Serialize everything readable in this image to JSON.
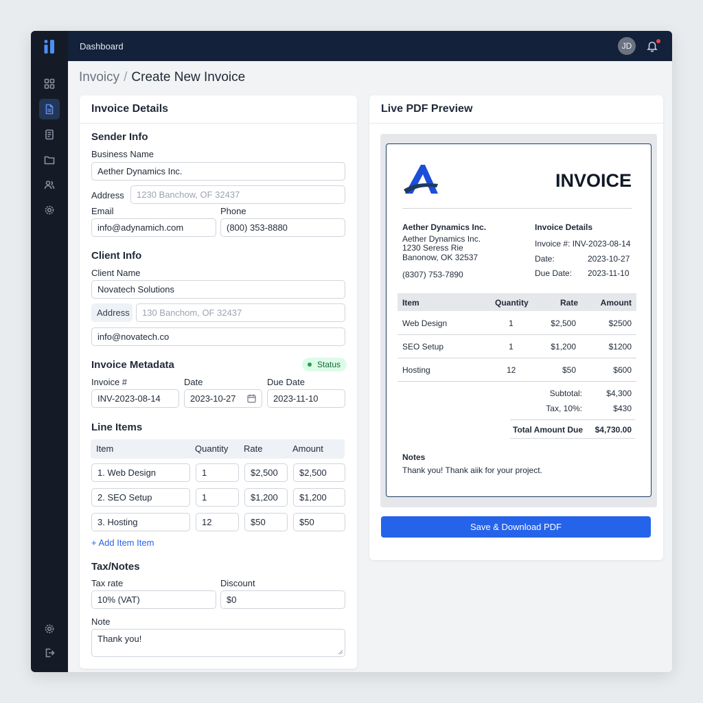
{
  "app": {
    "title": "Dashboard",
    "avatar_initials": "JD"
  },
  "breadcrumb": {
    "parent": "Invoicy",
    "separator": "/",
    "current": "Create New Invoice"
  },
  "form": {
    "card_title": "Invoice Details",
    "sender": {
      "title": "Sender Info",
      "business_label": "Business Name",
      "business_value": "Aether Dynamics Inc.",
      "address_label": "Address",
      "address_placeholder": "1230 Banchow, OF 32437",
      "email_label": "Email",
      "email_value": "info@adynamich.com",
      "phone_label": "Phone",
      "phone_value": "(800) 353-8880"
    },
    "client": {
      "title": "Client Info",
      "name_label": "Client Name",
      "name_value": "Novatech Solutions",
      "address_label": "Address",
      "address_placeholder": "130 Banchom, OF 32437",
      "email_value": "info@novatech.co"
    },
    "metadata": {
      "title": "Invoice Metadata",
      "status_label": "Status",
      "invoice_label": "Invoice #",
      "invoice_value": "INV-2023-08-14",
      "date_label": "Date",
      "date_value": "2023-10-27",
      "due_label": "Due Date",
      "due_value": "2023-11-10"
    },
    "line_items": {
      "title": "Line Items",
      "headers": [
        "Item",
        "Quantity",
        "Rate",
        "Amount"
      ],
      "rows": [
        {
          "item": "1. Web Design",
          "qty": "1",
          "rate": "$2,500",
          "amount": "$2,500"
        },
        {
          "item": "2. SEO Setup",
          "qty": "1",
          "rate": "$1,200",
          "amount": "$1,200"
        },
        {
          "item": "3. Hosting",
          "qty": "12",
          "rate": "$50",
          "amount": "$50"
        }
      ],
      "add_label": "+ Add Item Item"
    },
    "tax_notes": {
      "title": "Tax/Notes",
      "tax_label": "Tax rate",
      "tax_value": "10% (VAT)",
      "discount_label": "Discount",
      "discount_value": "$0",
      "note_label": "Note",
      "note_value": "Thank you!"
    }
  },
  "preview": {
    "card_title": "Live PDF Preview",
    "heading": "INVOICE",
    "sender": {
      "name": "Aether Dynamics Inc.",
      "line1": "Aether Dynamics Inc.",
      "line2": "1230 Seress Rie",
      "line3": "Banonow, OK 32537",
      "phone": "(8307) 753-7890"
    },
    "details": {
      "title": "Invoice Details",
      "invoice": "Invoice #: INV-2023-08-14",
      "date_label": "Date:",
      "date_value": "2023-10-27",
      "due_label": "Due Date:",
      "due_value": "2023-11-10"
    },
    "table": {
      "headers": [
        "Item",
        "Quantity",
        "Rate",
        "Amount"
      ],
      "rows": [
        {
          "item": "Web Design",
          "qty": "1",
          "rate": "$2,500",
          "amount": "$2500"
        },
        {
          "item": "SEO Setup",
          "qty": "1",
          "rate": "$1,200",
          "amount": "$1200"
        },
        {
          "item": "Hosting",
          "qty": "12",
          "rate": "$50",
          "amount": "$600"
        }
      ]
    },
    "totals": {
      "subtotal_label": "Subtotal:",
      "subtotal_value": "$4,300",
      "tax_label": "Tax, 10%:",
      "tax_value": "$430",
      "total_label": "Total Amount Due",
      "total_value": "$4,730.00"
    },
    "notes": {
      "title": "Notes",
      "text": "Thank you! Thank aiik for your project."
    },
    "save_button": "Save & Download PDF"
  },
  "colors": {
    "accent": "#2563eb",
    "topbar": "#14213b",
    "sidebar": "#151b26",
    "status": "#22a24f"
  },
  "icons": [
    "app-logo-icon",
    "grid-icon",
    "document-icon",
    "receipt-icon",
    "folder-icon",
    "users-icon",
    "gear-icon",
    "settings-icon",
    "logout-icon",
    "bell-icon",
    "calendar-icon"
  ]
}
